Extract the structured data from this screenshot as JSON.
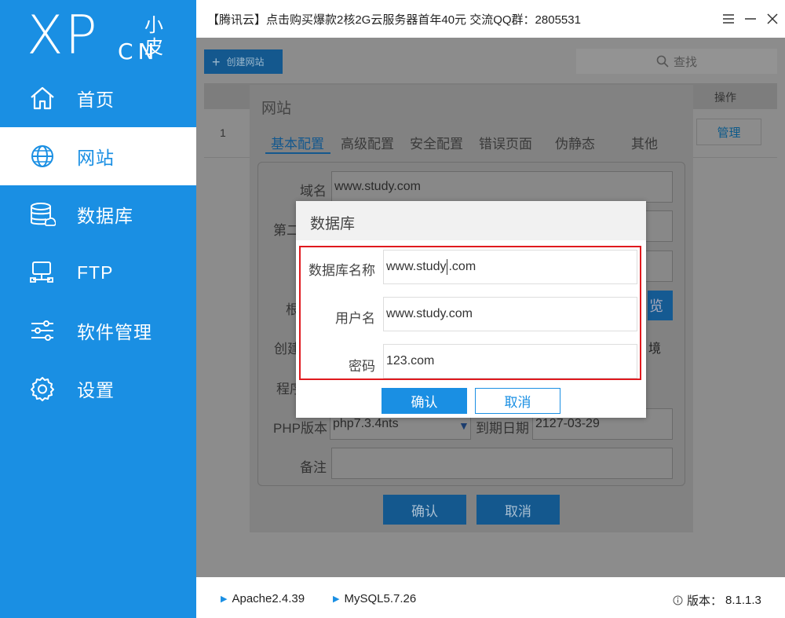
{
  "logo": {
    "brand": "XP",
    "cn": "小皮",
    "en": "CN"
  },
  "sidebar": {
    "items": [
      {
        "label": "首页",
        "icon": "home-icon",
        "active": false
      },
      {
        "label": "网站",
        "icon": "globe-icon",
        "active": true
      },
      {
        "label": "数据库",
        "icon": "database-icon",
        "active": false
      },
      {
        "label": "FTP",
        "icon": "ftp-icon",
        "active": false
      },
      {
        "label": "软件管理",
        "icon": "sliders-icon",
        "active": false
      },
      {
        "label": "设置",
        "icon": "gear-icon",
        "active": false
      }
    ]
  },
  "titlebar": {
    "title": "【腾讯云】点击购买爆款2核2G云服务器首年40元 交流QQ群：2805531"
  },
  "toolbar": {
    "create_label": "创建网站",
    "search_label": "查找"
  },
  "table": {
    "op_header": "操作",
    "rows": [
      {
        "num": "1",
        "manage_label": "管理"
      }
    ]
  },
  "site_dialog": {
    "title": "网站",
    "tabs": [
      "基本配置",
      "高级配置",
      "安全配置",
      "错误页面",
      "伪静态",
      "其他"
    ],
    "fields": {
      "domain_label": "域名",
      "domain_value": "www.study.com",
      "second_label": "第二",
      "root_label": "根",
      "browse_label": "览",
      "create_label": "创建",
      "env_label": "境",
      "program_label": "程序",
      "php_label": "PHP版本",
      "php_value": "php7.3.4nts",
      "expire_label": "到期日期",
      "expire_value": "2127-03-29",
      "note_label": "备注"
    },
    "confirm_label": "确认",
    "cancel_label": "取消"
  },
  "db_dialog": {
    "title": "数据库",
    "db_name_label": "数据库名称",
    "db_name_value_pre": "www.study",
    "db_name_value_post": ".com",
    "username_label": "用户名",
    "username_value": "www.study.com",
    "password_label": "密码",
    "password_value": "123.com",
    "confirm_label": "确认",
    "cancel_label": "取消"
  },
  "footer": {
    "apache": "Apache2.4.39",
    "mysql": "MySQL5.7.26",
    "version_label": "版本：",
    "version_value": "8.1.1.3"
  },
  "colors": {
    "accent": "#1a8fe3",
    "highlight": "#e0191e"
  }
}
